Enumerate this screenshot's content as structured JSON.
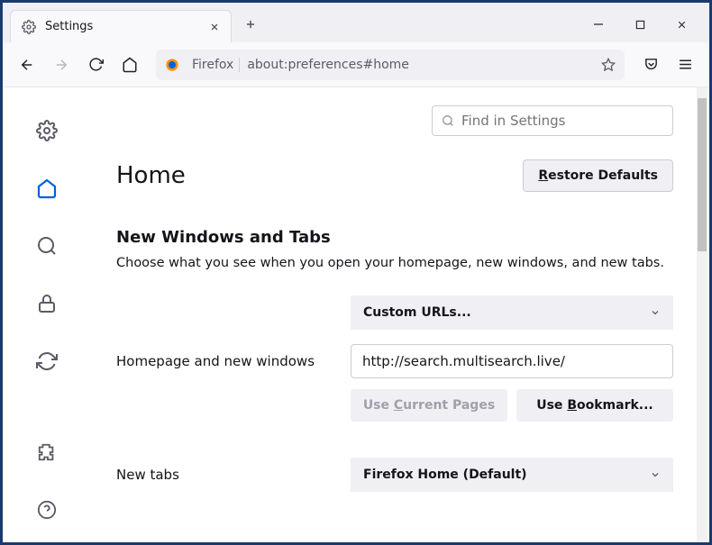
{
  "tab": {
    "title": "Settings"
  },
  "url": {
    "label": "Firefox",
    "address": "about:preferences#home"
  },
  "search": {
    "placeholder": "Find in Settings"
  },
  "page": {
    "title": "Home",
    "restore_label": "Restore Defaults",
    "section_heading": "New Windows and Tabs",
    "section_desc": "Choose what you see when you open your homepage, new windows, and new tabs."
  },
  "homepage": {
    "dropdown": "Custom URLs...",
    "label": "Homepage and new windows",
    "url_value": "http://search.multisearch.live/",
    "use_current": "Use Current Pages",
    "use_bookmark": "Use Bookmark..."
  },
  "newtabs": {
    "label": "New tabs",
    "dropdown": "Firefox Home (Default)"
  }
}
